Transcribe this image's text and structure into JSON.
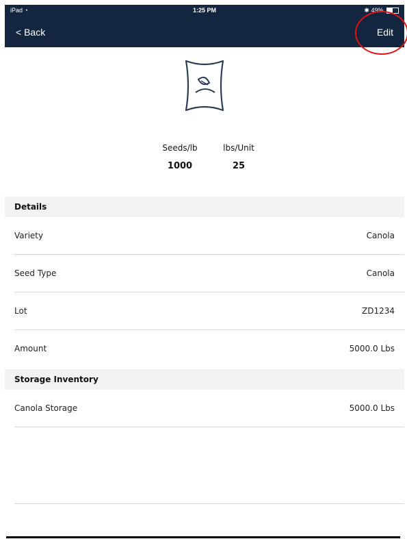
{
  "status": {
    "device": "iPad",
    "time": "1:25 PM",
    "battery": "49%",
    "battery_fraction": 0.49
  },
  "nav": {
    "back_label": "< Back",
    "edit_label": "Edit"
  },
  "product": {
    "icon": "seed-bag-icon",
    "seeds_per_lb_label": "Seeds/lb",
    "seeds_per_lb_value": "1000",
    "lbs_per_unit_label": "lbs/Unit",
    "lbs_per_unit_value": "25"
  },
  "details": {
    "header": "Details",
    "rows": [
      {
        "label": "Variety",
        "value": "Canola"
      },
      {
        "label": "Seed Type",
        "value": "Canola"
      },
      {
        "label": "Lot",
        "value": "ZD1234"
      },
      {
        "label": "Amount",
        "value": "5000.0 Lbs"
      }
    ]
  },
  "storage": {
    "header": "Storage Inventory",
    "rows": [
      {
        "label": "Canola Storage",
        "value": "5000.0 Lbs"
      }
    ]
  },
  "colors": {
    "nav_bg": "#142540",
    "annotation": "#e01414",
    "section_bg": "#f2f2f2"
  }
}
